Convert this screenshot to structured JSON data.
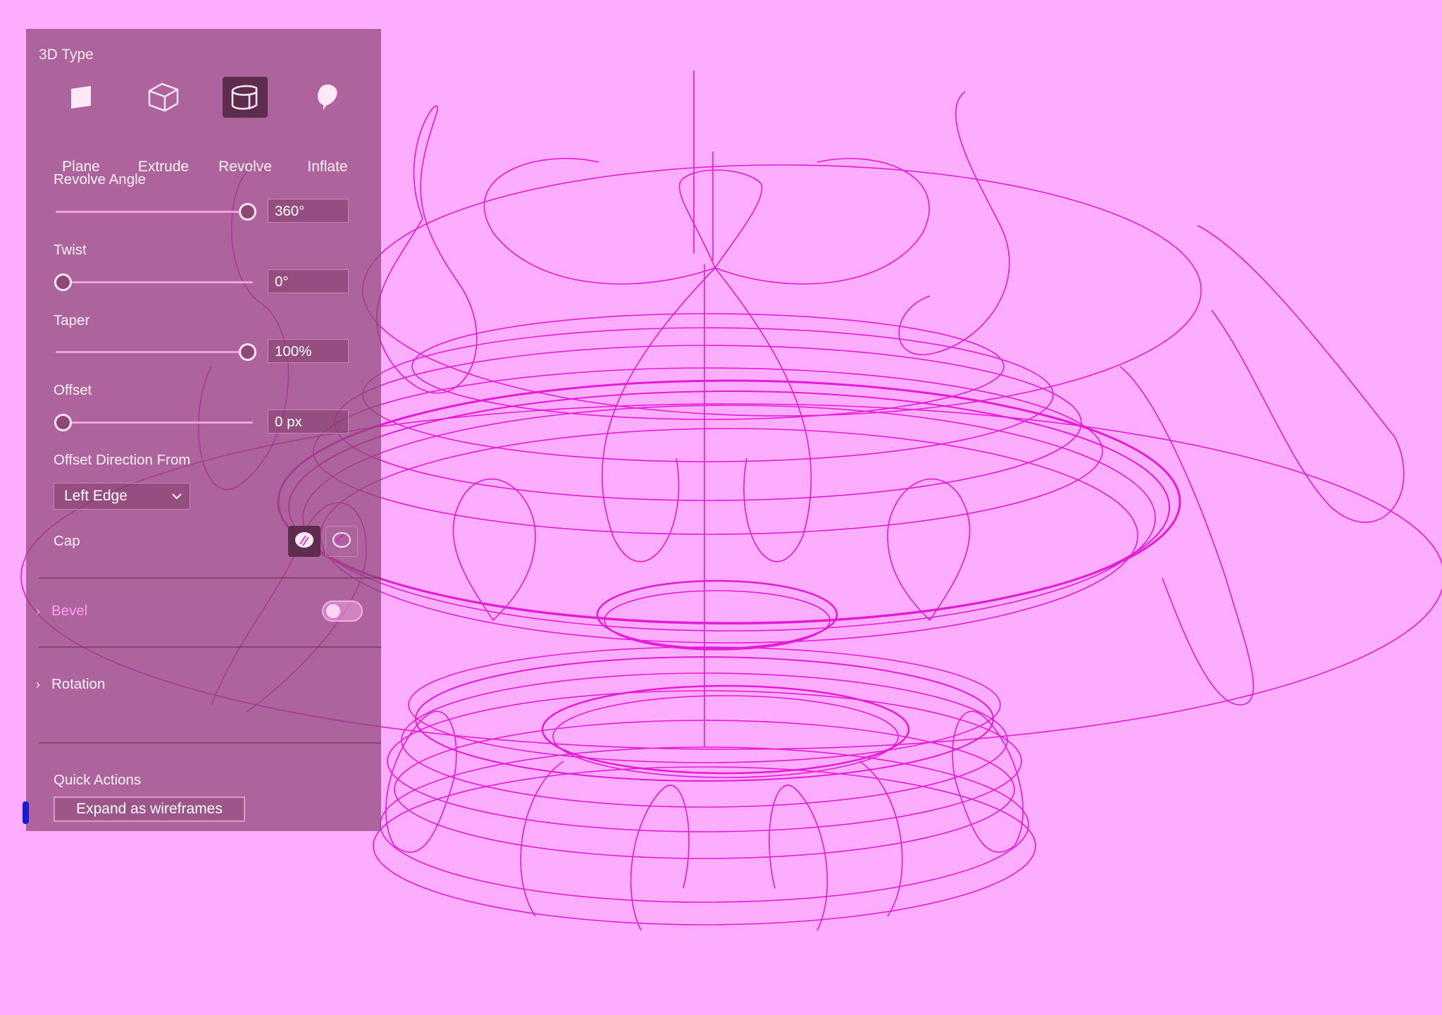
{
  "panel": {
    "title": "3D Type",
    "types": [
      {
        "label": "Plane",
        "icon": "plane-icon",
        "active": false
      },
      {
        "label": "Extrude",
        "icon": "extrude-icon",
        "active": false
      },
      {
        "label": "Revolve",
        "icon": "revolve-icon",
        "active": true
      },
      {
        "label": "Inflate",
        "icon": "inflate-icon",
        "active": false
      }
    ],
    "revolve_angle": {
      "label": "Revolve Angle",
      "value": "360°",
      "fraction": 1.0
    },
    "twist": {
      "label": "Twist",
      "value": "0°",
      "fraction": 0.0
    },
    "taper": {
      "label": "Taper",
      "value": "100%",
      "fraction": 1.0
    },
    "offset": {
      "label": "Offset",
      "value": "0 px",
      "fraction": 0.0
    },
    "offset_direction": {
      "label": "Offset Direction From",
      "selected": "Left Edge"
    },
    "cap": {
      "label": "Cap",
      "selected": 0,
      "icons": [
        "cap-on-icon",
        "cap-off-icon"
      ]
    },
    "bevel": {
      "label": "Bevel",
      "enabled": false
    },
    "rotation": {
      "label": "Rotation"
    },
    "quick_actions": {
      "label": "Quick Actions",
      "button": "Expand as wireframes"
    }
  },
  "colors": {
    "canvas_bg": "#fdadfd",
    "wire": "#e41ad7",
    "panel_bg": "#8d4876",
    "active_bg": "#5e2d4d",
    "focus_marker": "#1d1ad6"
  }
}
